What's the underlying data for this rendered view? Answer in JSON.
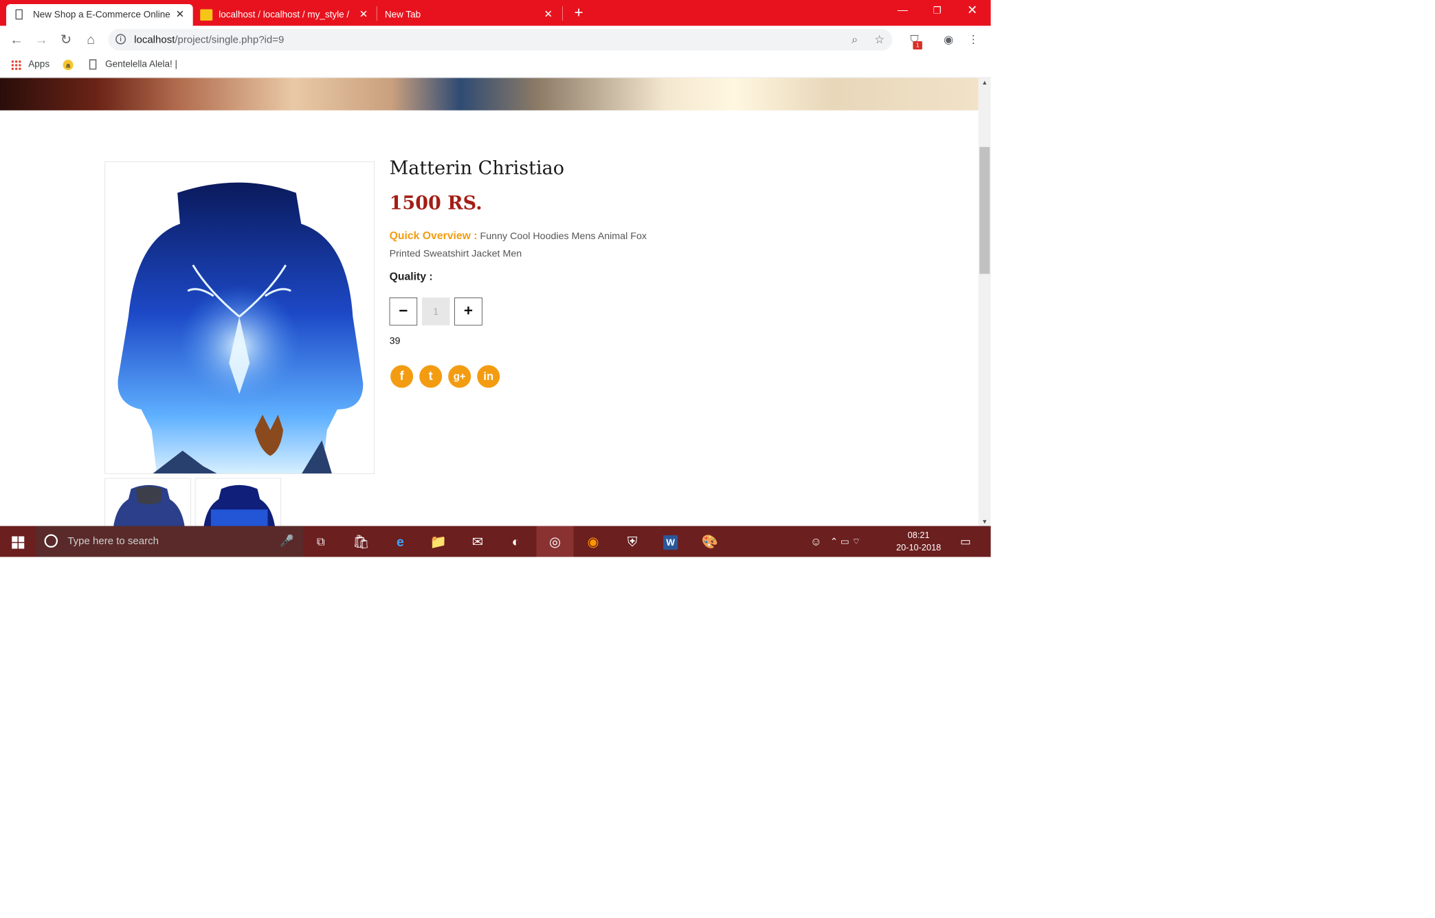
{
  "browser": {
    "tabs": [
      {
        "title": "New Shop a E-Commerce Online",
        "active": true
      },
      {
        "title": "localhost / localhost / my_style /",
        "active": false
      },
      {
        "title": "New Tab",
        "active": false
      }
    ],
    "url_host": "localhost",
    "url_path": "/project/single.php?id=9",
    "extension_badge": "1",
    "bookmarks": [
      "Apps",
      "Gentelella Alela! |"
    ]
  },
  "product": {
    "name": "Matterin Christiao",
    "price": "1500 RS.",
    "overview_label": "Quick Overview :",
    "overview_text": "Funny Cool Hoodies Mens Animal Fox Printed Sweatshirt Jacket Men",
    "quality_label": "Quality :",
    "quantity_value": "1",
    "stock_count": "39"
  },
  "social": [
    {
      "icon": "facebook-icon",
      "glyph": "f"
    },
    {
      "icon": "twitter-icon",
      "glyph": "t"
    },
    {
      "icon": "google-plus-icon",
      "glyph": "g+"
    },
    {
      "icon": "linkedin-icon",
      "glyph": "in"
    }
  ],
  "taskbar": {
    "search_placeholder": "Type here to search",
    "time": "08:21",
    "date": "20-10-2018"
  },
  "colors": {
    "tabstrip": "#e8121e",
    "price": "#a41d14",
    "accent": "#f39c12",
    "taskbar": "#6b1f1f"
  }
}
